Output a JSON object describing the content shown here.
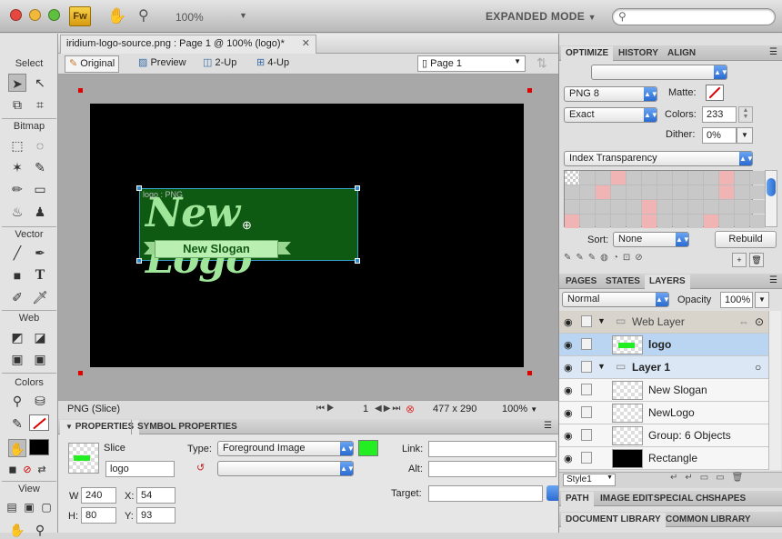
{
  "titlebar": {
    "zoom": "100%",
    "mode": "EXPANDED MODE",
    "app_badge": "Fw"
  },
  "tools": {
    "sections": [
      "Select",
      "Bitmap",
      "Vector",
      "Web",
      "Colors",
      "View"
    ]
  },
  "document": {
    "tab_title": "iridium-logo-source.png : Page 1 @ 100% (logo)*",
    "views": [
      "Original",
      "Preview",
      "2-Up",
      "4-Up"
    ],
    "page": "Page 1",
    "logo_text": "New Logo",
    "slogan_text": "New Slogan",
    "slice_label": "logo : PNG"
  },
  "status": {
    "format": "PNG (Slice)",
    "frame": "1",
    "size": "477 x 290",
    "zoom": "100%"
  },
  "properties": {
    "tabs": [
      "PROPERTIES",
      "SYMBOL PROPERTIES"
    ],
    "kind": "Slice",
    "name": "logo",
    "type_label": "Type:",
    "type_value": "Foreground Image",
    "link_label": "Link:",
    "alt_label": "Alt:",
    "target_label": "Target:",
    "w": "240",
    "h": "80",
    "x": "54",
    "y": "93",
    "w_label": "W",
    "h_label": "H:",
    "x_label": "X:",
    "y_label": "Y:",
    "slice_color": "#22ee22"
  },
  "optimize": {
    "tabs": [
      "OPTIMIZE",
      "HISTORY",
      "ALIGN"
    ],
    "format": "PNG 8",
    "matte_label": "Matte:",
    "palette": "Exact",
    "colors_label": "Colors:",
    "colors": "233",
    "dither_label": "Dither:",
    "dither": "0%",
    "transparency": "Index Transparency",
    "sort_label": "Sort:",
    "sort": "None",
    "rebuild": "Rebuild"
  },
  "layers": {
    "tabs": [
      "PAGES",
      "STATES",
      "LAYERS"
    ],
    "blend": "Normal",
    "opacity_label": "Opacity",
    "opacity": "100%",
    "items": [
      {
        "name": "Web Layer"
      },
      {
        "name": "logo"
      },
      {
        "name": "Layer 1"
      },
      {
        "name": "New Slogan"
      },
      {
        "name": "NewLogo"
      },
      {
        "name": "Group: 6 Objects"
      },
      {
        "name": "Rectangle"
      }
    ],
    "style": "Style1"
  },
  "bottom_tabs": {
    "row1": [
      "PATH",
      "IMAGE EDIT",
      "SPECIAL CH",
      "SHAPES"
    ],
    "row2": [
      "DOCUMENT LIBRARY",
      "COMMON LIBRARY"
    ]
  }
}
